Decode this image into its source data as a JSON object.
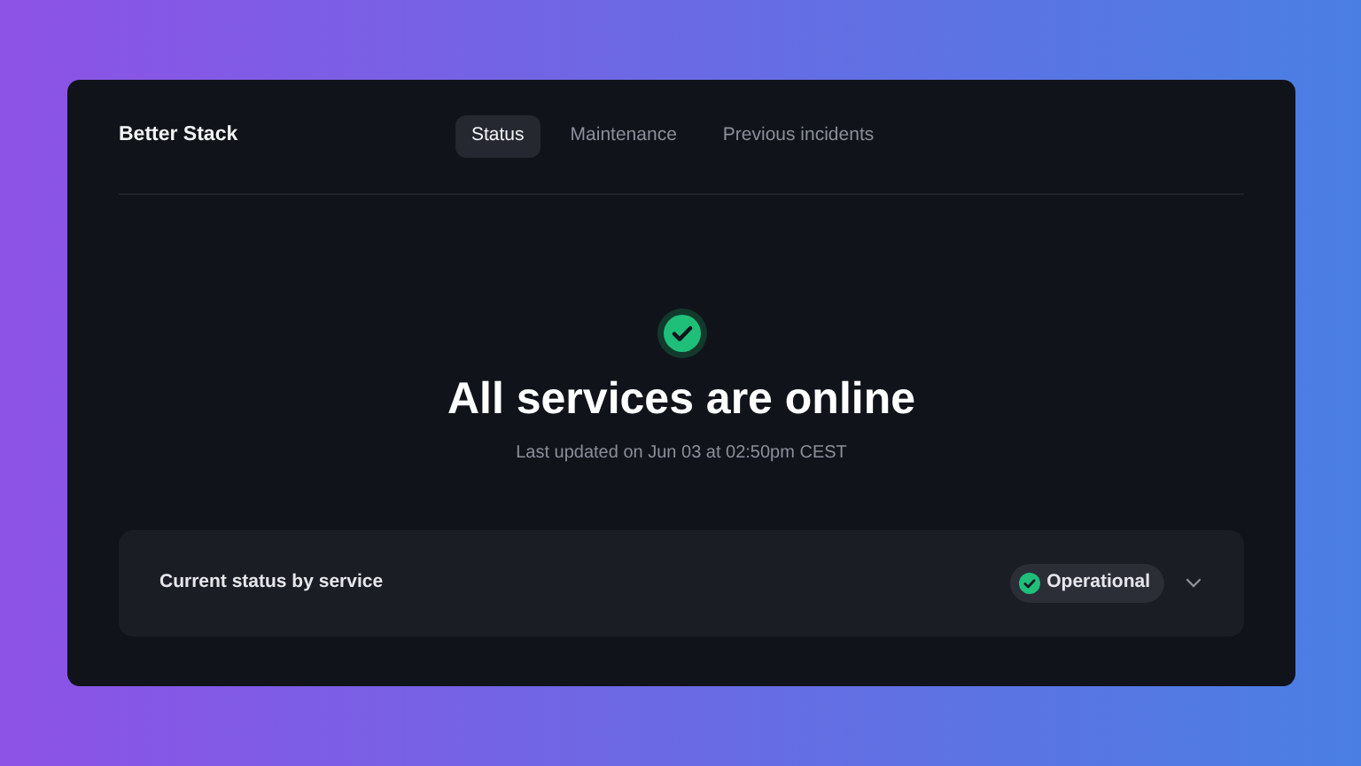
{
  "brand": "Better Stack",
  "tabs": [
    {
      "label": "Status",
      "selected": true
    },
    {
      "label": "Maintenance",
      "selected": false
    },
    {
      "label": "Previous incidents",
      "selected": false
    }
  ],
  "hero": {
    "title": "All services are online",
    "updated": "Last updated on Jun 03 at 02:50pm CEST"
  },
  "service_panel": {
    "label": "Current status by service",
    "status": "Operational",
    "expanded": false
  }
}
